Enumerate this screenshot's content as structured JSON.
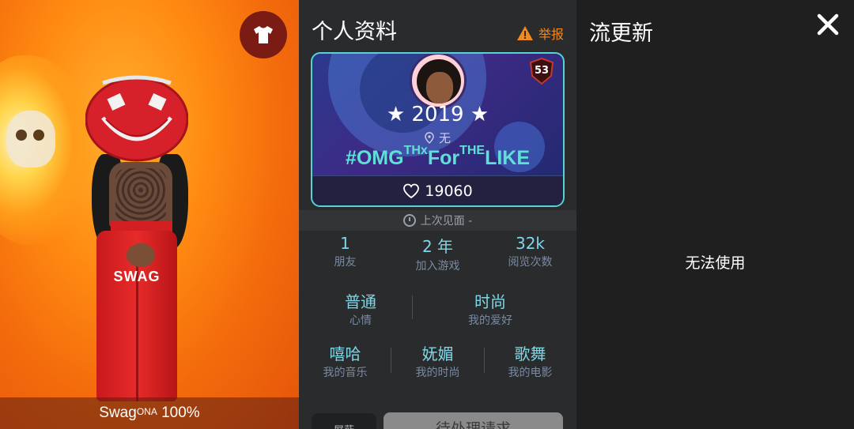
{
  "avatar_panel": {
    "shirt_text": "SWAG",
    "display_name_main": "Swag",
    "display_name_sup": "ONA",
    "display_name_suffix": " 100%",
    "outfit_icon": "tshirt-icon"
  },
  "profile": {
    "title": "个人资料",
    "report_label": "举报",
    "card": {
      "level": "53",
      "name": "★ 2019 ★",
      "location": "无",
      "motto": {
        "p1": "#OMG",
        "s1": "THx",
        "p2": "For",
        "s2": "THE",
        "p3": "LIKE"
      },
      "likes": "19060"
    },
    "last_seen": "上次见面 -",
    "stats": [
      {
        "value": "1",
        "label": "朋友"
      },
      {
        "value": "2 年",
        "label": "加入游戏"
      },
      {
        "value": "32k",
        "label": "阅览次数"
      }
    ],
    "mood": {
      "value": "普通",
      "label": "心情"
    },
    "hobby": {
      "value": "时尚",
      "label": "我的爱好"
    },
    "favorites": [
      {
        "value": "嘻哈",
        "label": "我的音乐"
      },
      {
        "value": "妩媚",
        "label": "我的时尚"
      },
      {
        "value": "歌舞",
        "label": "我的电影"
      }
    ],
    "button_left": "屏蔽",
    "button_right": "待处理请求"
  },
  "feed": {
    "title": "流更新",
    "unavailable": "无法使用",
    "close_icon": "close-icon"
  },
  "colors": {
    "accent_cyan": "#5fe0d6",
    "stat_value": "#7fd6e6",
    "report_orange": "#f08a1f"
  }
}
